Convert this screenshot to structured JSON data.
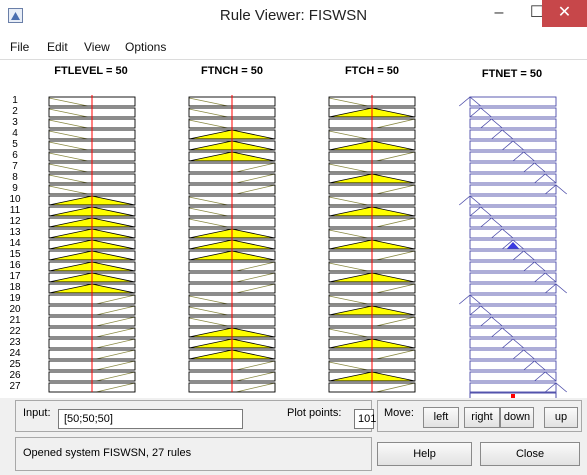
{
  "window": {
    "title": "Rule Viewer: FISWSN",
    "minimize": "–",
    "maximize": "☐",
    "close": "✕"
  },
  "menu": [
    "File",
    "Edit",
    "View",
    "Options"
  ],
  "columns": [
    {
      "title": "FTLEVEL = 50",
      "input_value": 50,
      "active_rules": [
        10,
        11,
        12,
        13,
        14,
        15,
        16,
        17,
        18
      ]
    },
    {
      "title": "FTNCH = 50",
      "input_value": 50,
      "active_rules": [
        4,
        5,
        6,
        13,
        14,
        15,
        22,
        23,
        24
      ]
    },
    {
      "title": "FTCH = 50",
      "input_value": 50,
      "active_rules": [
        2,
        5,
        8,
        11,
        14,
        17,
        20,
        23,
        26
      ]
    }
  ],
  "output": {
    "title": "FTNET = 50",
    "fired_rule": 14
  },
  "rules": [
    "1",
    "2",
    "3",
    "4",
    "5",
    "6",
    "7",
    "8",
    "9",
    "10",
    "11",
    "12",
    "13",
    "14",
    "15",
    "16",
    "17",
    "18",
    "19",
    "20",
    "21",
    "22",
    "23",
    "24",
    "25",
    "26",
    "27"
  ],
  "input_panel": {
    "label": "Input:",
    "value": "[50;50;50]",
    "plot_points_label": "Plot points:",
    "plot_points": "101"
  },
  "move_panel": {
    "label": "Move:",
    "left": "left",
    "right": "right",
    "down": "down",
    "up": "up"
  },
  "status": "Opened system FISWSN, 27 rules",
  "buttons": {
    "help": "Help",
    "close": "Close"
  },
  "colors": {
    "fill": "#ffff00",
    "output_line": "#4a4aa8",
    "output_fill": "#3a3ae0",
    "center_line": "#ff0000",
    "inactive": "#8a8a44"
  }
}
